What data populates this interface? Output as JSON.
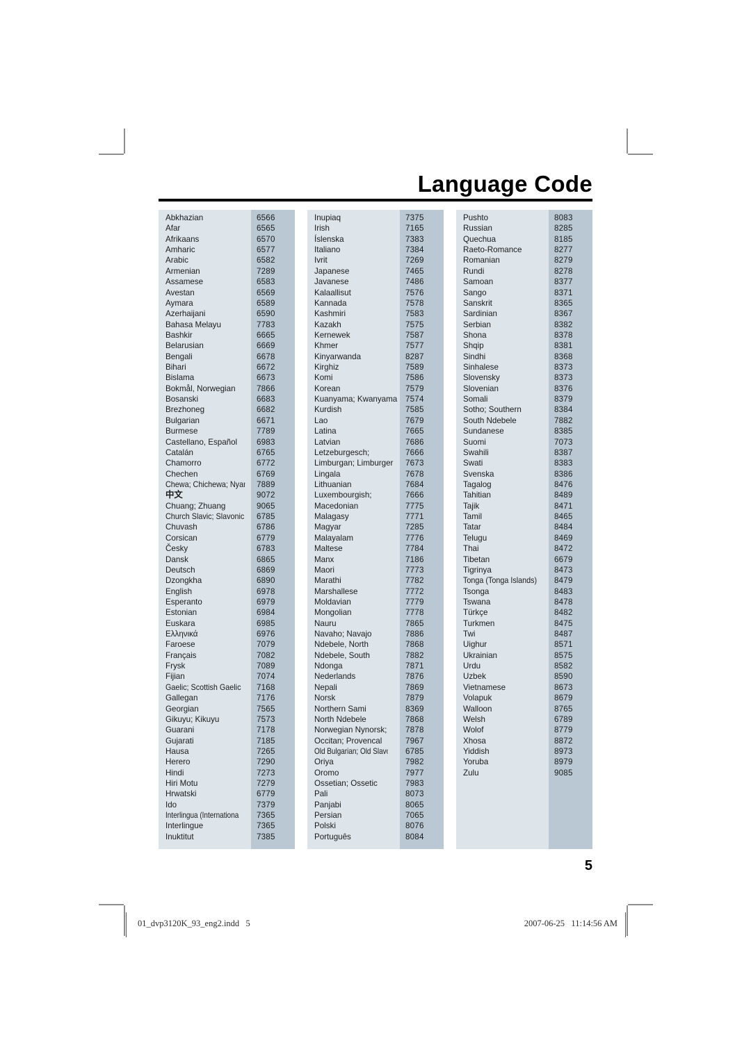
{
  "page": {
    "title": "Language Code",
    "page_number": "5",
    "footer_left": "01_dvp3120K_93_eng2.indd   5",
    "footer_right": "2007-06-25   11:14:56 AM",
    "colors": {
      "name_cell_background": "#dde4ea",
      "code_cell_background": "#b9c8d2",
      "text": "#1a1a1a",
      "rule": "#000000"
    }
  },
  "table": {
    "columns": [
      {
        "id": "column-1",
        "rows": [
          {
            "language": "Abkhazian",
            "code": "6566"
          },
          {
            "language": "Afar",
            "code": "6565"
          },
          {
            "language": "Afrikaans",
            "code": "6570"
          },
          {
            "language": "Amharic",
            "code": "6577"
          },
          {
            "language": "Arabic",
            "code": "6582"
          },
          {
            "language": "Armenian",
            "code": "7289"
          },
          {
            "language": "Assamese",
            "code": "6583"
          },
          {
            "language": "Avestan",
            "code": "6569"
          },
          {
            "language": "Aymara",
            "code": "6589"
          },
          {
            "language": "Azerhaijani",
            "code": "6590"
          },
          {
            "language": "Bahasa Melayu",
            "code": "7783"
          },
          {
            "language": "Bashkir",
            "code": "6665"
          },
          {
            "language": "Belarusian",
            "code": "6669"
          },
          {
            "language": "Bengali",
            "code": "6678"
          },
          {
            "language": "Bihari",
            "code": "6672"
          },
          {
            "language": "Bislama",
            "code": "6673"
          },
          {
            "language": "Bokmål, Norwegian",
            "code": "7866"
          },
          {
            "language": "Bosanski",
            "code": "6683"
          },
          {
            "language": "Brezhoneg",
            "code": "6682"
          },
          {
            "language": "Bulgarian",
            "code": "6671"
          },
          {
            "language": "Burmese",
            "code": "7789"
          },
          {
            "language": "Castellano, Español",
            "code": "6983"
          },
          {
            "language": "Catalán",
            "code": "6765"
          },
          {
            "language": "Chamorro",
            "code": "6772"
          },
          {
            "language": "Chechen",
            "code": "6769"
          },
          {
            "language": "Chewa; Chichewa; Nyanja",
            "code": "7889"
          },
          {
            "language": "中文",
            "code": "9072"
          },
          {
            "language": "Chuang; Zhuang",
            "code": "9065"
          },
          {
            "language": "Church Slavic; Slavonic",
            "code": "6785"
          },
          {
            "language": "Chuvash",
            "code": "6786"
          },
          {
            "language": "Corsican",
            "code": "6779"
          },
          {
            "language": "Česky",
            "code": "6783"
          },
          {
            "language": "Dansk",
            "code": "6865"
          },
          {
            "language": "Deutsch",
            "code": "6869"
          },
          {
            "language": "Dzongkha",
            "code": "6890"
          },
          {
            "language": "English",
            "code": "6978"
          },
          {
            "language": "Esperanto",
            "code": "6979"
          },
          {
            "language": "Estonian",
            "code": "6984"
          },
          {
            "language": "Euskara",
            "code": "6985"
          },
          {
            "language": "Ελληνικά",
            "code": "6976"
          },
          {
            "language": "Faroese",
            "code": "7079"
          },
          {
            "language": "Français",
            "code": "7082"
          },
          {
            "language": "Frysk",
            "code": "7089"
          },
          {
            "language": "Fijian",
            "code": "7074"
          },
          {
            "language": "Gaelic; Scottish Gaelic",
            "code": "7168"
          },
          {
            "language": "Gallegan",
            "code": "7176"
          },
          {
            "language": "Georgian",
            "code": "7565"
          },
          {
            "language": "Gikuyu; Kikuyu",
            "code": "7573"
          },
          {
            "language": "Guarani",
            "code": "7178"
          },
          {
            "language": "Gujarati",
            "code": "7185"
          },
          {
            "language": "Hausa",
            "code": "7265"
          },
          {
            "language": "Herero",
            "code": "7290"
          },
          {
            "language": "Hindi",
            "code": "7273"
          },
          {
            "language": "Hiri Motu",
            "code": "7279"
          },
          {
            "language": "Hrwatski",
            "code": "6779"
          },
          {
            "language": "Ido",
            "code": "7379"
          },
          {
            "language": "Interlingua (International)",
            "code": "7365"
          },
          {
            "language": "Interlingue",
            "code": "7365"
          },
          {
            "language": "Inuktitut",
            "code": "7385"
          }
        ]
      },
      {
        "id": "column-2",
        "rows": [
          {
            "language": "Inupiaq",
            "code": "7375"
          },
          {
            "language": "Irish",
            "code": "7165"
          },
          {
            "language": "Íslenska",
            "code": "7383"
          },
          {
            "language": "Italiano",
            "code": "7384"
          },
          {
            "language": "Ivrit",
            "code": "7269"
          },
          {
            "language": "Japanese",
            "code": "7465"
          },
          {
            "language": "Javanese",
            "code": "7486"
          },
          {
            "language": "Kalaallisut",
            "code": "7576"
          },
          {
            "language": "Kannada",
            "code": "7578"
          },
          {
            "language": "Kashmiri",
            "code": "7583"
          },
          {
            "language": "Kazakh",
            "code": "7575"
          },
          {
            "language": "Kernewek",
            "code": "7587"
          },
          {
            "language": "Khmer",
            "code": "7577"
          },
          {
            "language": "Kinyarwanda",
            "code": "8287"
          },
          {
            "language": "Kirghiz",
            "code": "7589"
          },
          {
            "language": "Komi",
            "code": "7586"
          },
          {
            "language": "Korean",
            "code": "7579"
          },
          {
            "language": "Kuanyama; Kwanyama",
            "code": "7574"
          },
          {
            "language": "Kurdish",
            "code": "7585"
          },
          {
            "language": "Lao",
            "code": "7679"
          },
          {
            "language": "Latina",
            "code": "7665"
          },
          {
            "language": "Latvian",
            "code": "7686"
          },
          {
            "language": "Letzeburgesch;",
            "code": "7666"
          },
          {
            "language": "Limburgan; Limburger",
            "code": "7673"
          },
          {
            "language": "Lingala",
            "code": "7678"
          },
          {
            "language": "Lithuanian",
            "code": "7684"
          },
          {
            "language": "Luxembourgish;",
            "code": "7666"
          },
          {
            "language": "Macedonian",
            "code": "7775"
          },
          {
            "language": "Malagasy",
            "code": "7771"
          },
          {
            "language": "Magyar",
            "code": "7285"
          },
          {
            "language": "Malayalam",
            "code": "7776"
          },
          {
            "language": "Maltese",
            "code": "7784"
          },
          {
            "language": "Manx",
            "code": "7186"
          },
          {
            "language": "Maori",
            "code": "7773"
          },
          {
            "language": "Marathi",
            "code": "7782"
          },
          {
            "language": "Marshallese",
            "code": "7772"
          },
          {
            "language": "Moldavian",
            "code": "7779"
          },
          {
            "language": "Mongolian",
            "code": "7778"
          },
          {
            "language": "Nauru",
            "code": "7865"
          },
          {
            "language": "Navaho; Navajo",
            "code": "7886"
          },
          {
            "language": "Ndebele, North",
            "code": "7868"
          },
          {
            "language": "Ndebele, South",
            "code": "7882"
          },
          {
            "language": "Ndonga",
            "code": "7871"
          },
          {
            "language": "Nederlands",
            "code": "7876"
          },
          {
            "language": "Nepali",
            "code": "7869"
          },
          {
            "language": "Norsk",
            "code": "7879"
          },
          {
            "language": "Northern Sami",
            "code": "8369"
          },
          {
            "language": "North Ndebele",
            "code": "7868"
          },
          {
            "language": "Norwegian Nynorsk;",
            "code": "7878"
          },
          {
            "language": "Occitan; Provencal",
            "code": "7967"
          },
          {
            "language": "Old Bulgarian; Old Slavonic",
            "code": "6785"
          },
          {
            "language": "Oriya",
            "code": "7982"
          },
          {
            "language": "Oromo",
            "code": "7977"
          },
          {
            "language": "Ossetian; Ossetic",
            "code": "7983"
          },
          {
            "language": "Pali",
            "code": "8073"
          },
          {
            "language": "Panjabi",
            "code": "8065"
          },
          {
            "language": "Persian",
            "code": "7065"
          },
          {
            "language": "Polski",
            "code": "8076"
          },
          {
            "language": "Português",
            "code": "8084"
          }
        ]
      },
      {
        "id": "column-3",
        "rows": [
          {
            "language": "Pushto",
            "code": "8083"
          },
          {
            "language": "Russian",
            "code": "8285"
          },
          {
            "language": "Quechua",
            "code": "8185"
          },
          {
            "language": "Raeto-Romance",
            "code": "8277"
          },
          {
            "language": "Romanian",
            "code": "8279"
          },
          {
            "language": "Rundi",
            "code": "8278"
          },
          {
            "language": "Samoan",
            "code": "8377"
          },
          {
            "language": "Sango",
            "code": "8371"
          },
          {
            "language": "Sanskrit",
            "code": "8365"
          },
          {
            "language": "Sardinian",
            "code": "8367"
          },
          {
            "language": "Serbian",
            "code": "8382"
          },
          {
            "language": "Shona",
            "code": "8378"
          },
          {
            "language": "Shqip",
            "code": "8381"
          },
          {
            "language": "Sindhi",
            "code": "8368"
          },
          {
            "language": "Sinhalese",
            "code": "8373"
          },
          {
            "language": "Slovensky",
            "code": "8373"
          },
          {
            "language": "Slovenian",
            "code": "8376"
          },
          {
            "language": "Somali",
            "code": "8379"
          },
          {
            "language": "Sotho; Southern",
            "code": "8384"
          },
          {
            "language": "South Ndebele",
            "code": "7882"
          },
          {
            "language": "Sundanese",
            "code": "8385"
          },
          {
            "language": "Suomi",
            "code": "7073"
          },
          {
            "language": "Swahili",
            "code": "8387"
          },
          {
            "language": "Swati",
            "code": "8383"
          },
          {
            "language": "Svenska",
            "code": "8386"
          },
          {
            "language": "Tagalog",
            "code": "8476"
          },
          {
            "language": "Tahitian",
            "code": "8489"
          },
          {
            "language": "Tajik",
            "code": "8471"
          },
          {
            "language": "Tamil",
            "code": "8465"
          },
          {
            "language": "Tatar",
            "code": "8484"
          },
          {
            "language": "Telugu",
            "code": "8469"
          },
          {
            "language": "Thai",
            "code": "8472"
          },
          {
            "language": "Tibetan",
            "code": "6679"
          },
          {
            "language": "Tigrinya",
            "code": "8473"
          },
          {
            "language": "Tonga (Tonga Islands)",
            "code": "8479"
          },
          {
            "language": "Tsonga",
            "code": "8483"
          },
          {
            "language": "Tswana",
            "code": "8478"
          },
          {
            "language": "Türkçe",
            "code": "8482"
          },
          {
            "language": "Turkmen",
            "code": "8475"
          },
          {
            "language": "Twi",
            "code": "8487"
          },
          {
            "language": "Uighur",
            "code": "8571"
          },
          {
            "language": "Ukrainian",
            "code": "8575"
          },
          {
            "language": "Urdu",
            "code": "8582"
          },
          {
            "language": "Uzbek",
            "code": "8590"
          },
          {
            "language": "Vietnamese",
            "code": "8673"
          },
          {
            "language": "Volapuk",
            "code": "8679"
          },
          {
            "language": "Walloon",
            "code": "8765"
          },
          {
            "language": "Welsh",
            "code": "6789"
          },
          {
            "language": "Wolof",
            "code": "8779"
          },
          {
            "language": "Xhosa",
            "code": "8872"
          },
          {
            "language": "Yiddish",
            "code": "8973"
          },
          {
            "language": "Yoruba",
            "code": "8979"
          },
          {
            "language": "Zulu",
            "code": "9085"
          }
        ]
      }
    ]
  }
}
